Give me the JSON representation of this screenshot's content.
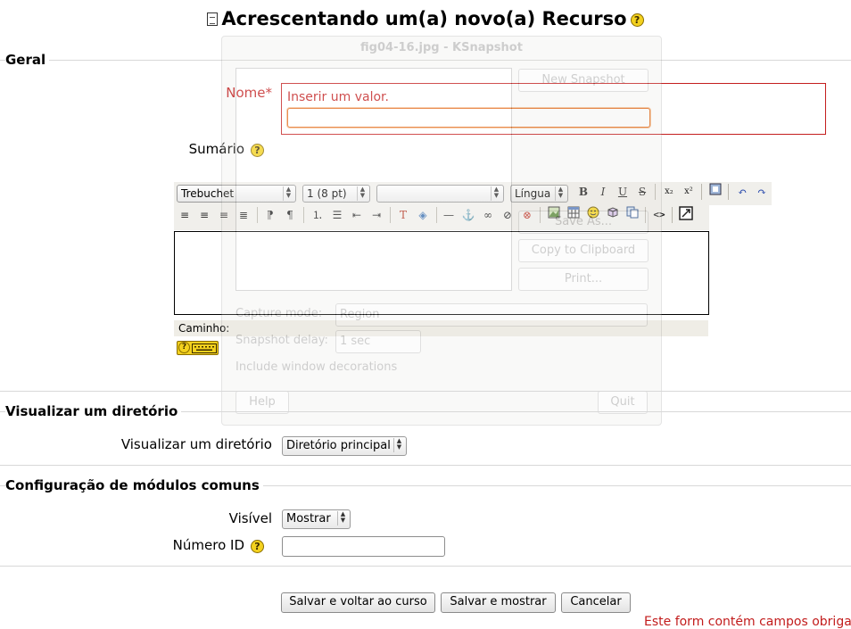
{
  "page": {
    "title": "Acrescentando um(a) novo(a) Recurso",
    "title_icon": "document-icon",
    "help_icon_glyph": "?"
  },
  "sections": {
    "general": {
      "legend": "Geral",
      "name_label": "Nome*",
      "name_error": "Inserir um valor.",
      "name_value": "",
      "summary_label": "Sumário"
    },
    "directory": {
      "legend": "Visualizar um diretório",
      "field_label": "Visualizar um diretório",
      "selected": "Diretório principal"
    },
    "common": {
      "legend": "Configuração de módulos comuns",
      "visible_label": "Visível",
      "visible_selected": "Mostrar",
      "idnumber_label": "Número ID",
      "idnumber_value": ""
    }
  },
  "editor": {
    "font_family": "Trebuchet",
    "font_size": "1 (8 pt)",
    "format": "",
    "language": "Língua",
    "toolbar1": [
      "bold",
      "italic",
      "underline",
      "strikethrough",
      "subscript",
      "superscript",
      "paste-word",
      "undo",
      "redo"
    ],
    "toolbar2": [
      "align-left",
      "align-center",
      "align-right",
      "justify",
      "ltr",
      "rtl",
      "ordered-list",
      "unordered-list",
      "outdent",
      "indent",
      "text-color",
      "background-color",
      "horizontal-rule",
      "anchor",
      "link",
      "unlink",
      "nolink",
      "image",
      "table",
      "smiley",
      "insert-character",
      "search-replace",
      "html-source",
      "fullscreen"
    ],
    "bold_glyph": "B",
    "italic_glyph": "I",
    "underline_glyph": "U",
    "strike_glyph": "S",
    "sub_glyph": "x₂",
    "sup_glyph": "x²",
    "path_label": "Caminho:",
    "keyboard_icon": "keyboard-help-icon"
  },
  "buttons": {
    "save_return": "Salvar e voltar ao curso",
    "save_show": "Salvar e mostrar",
    "cancel": "Cancelar"
  },
  "footer_note": "Este form contém campos obriga",
  "ksnapshot_overlay": {
    "window_title": "fig04-16.jpg - KSnapshot",
    "new_snapshot": "New Snapshot",
    "save_as": "Save As...",
    "copy": "Copy to Clipboard",
    "print": "Print...",
    "capture_mode_label": "Capture mode:",
    "capture_mode_value": "Region",
    "delay_label": "Snapshot delay:",
    "delay_value": "1 sec",
    "include_decorations": "Include window decorations",
    "help": "Help",
    "quit": "Quit"
  },
  "colors": {
    "error_red": "#c21c1c",
    "help_yellow": "#f3d11e",
    "toolbar_bg": "#f0efeb"
  }
}
